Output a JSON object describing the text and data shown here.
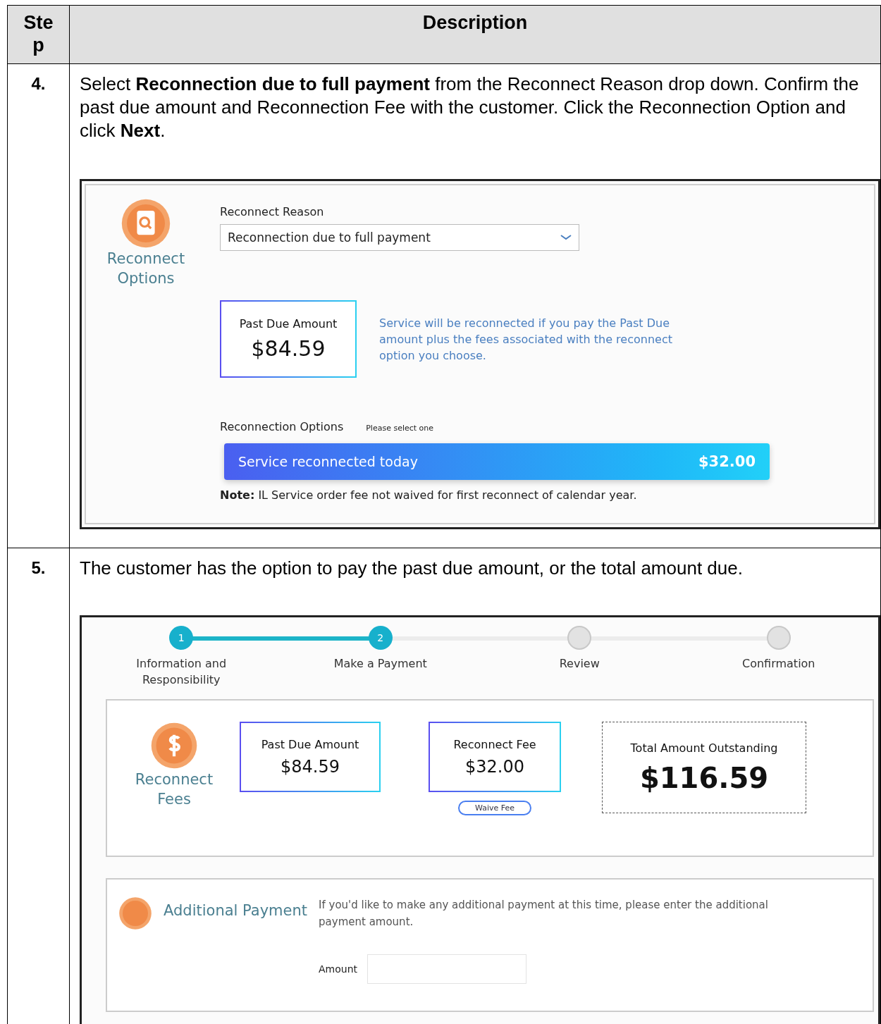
{
  "table": {
    "columns": [
      "Step",
      "Description"
    ],
    "rows": [
      {
        "step": "4.",
        "text": "Select **Reconnection due to full payment** from the Reconnect Reason drop down. Confirm the past due amount and Reconnection Fee with the customer.  Click the Reconnection Option and click **Next**.",
        "screen": {
          "kind": "options",
          "section_title": "Reconnect Options",
          "reason_label": "Reconnect Reason",
          "reason_value": "Reconnection due to full payment",
          "past_due": {
            "label": "Past Due Amount",
            "amount": "$84.59"
          },
          "info": "Service will be reconnected if you pay the Past Due amount plus the fees associated with the reconnect option you choose.",
          "options_label": "Reconnection Options",
          "options_hint": "Please select one",
          "options": [
            {
              "label": "Service reconnected today",
              "price": "$32.00"
            }
          ],
          "note_label": "Note:",
          "note": "IL Service order fee not waived for first reconnect of calendar year."
        }
      },
      {
        "step": "5.",
        "text": "The customer has the option to pay the past due amount, or the total amount due.",
        "screen": {
          "kind": "payment",
          "steps": [
            {
              "number": "1",
              "label": "Information and Responsibility",
              "reached": true
            },
            {
              "number": "2",
              "label": "Make a Payment",
              "reached": true
            },
            {
              "label": "Review",
              "reached": false
            },
            {
              "label": "Confirmation",
              "reached": false
            }
          ],
          "fees_title": "Reconnect Fees",
          "past_due": {
            "label": "Past Due Amount",
            "amount": "$84.59"
          },
          "fee": {
            "label": "Reconnect Fee",
            "amount": "$32.00"
          },
          "waive_button": "Waive Fee",
          "total": {
            "label": "Total Amount Outstanding",
            "amount": "$116.59"
          },
          "additional_title": "Additional Payment",
          "additional_text": "If you'd like to make any additional payment at this time, please enter the additional payment amount.",
          "amount_label": "Amount"
        }
      }
    ]
  }
}
